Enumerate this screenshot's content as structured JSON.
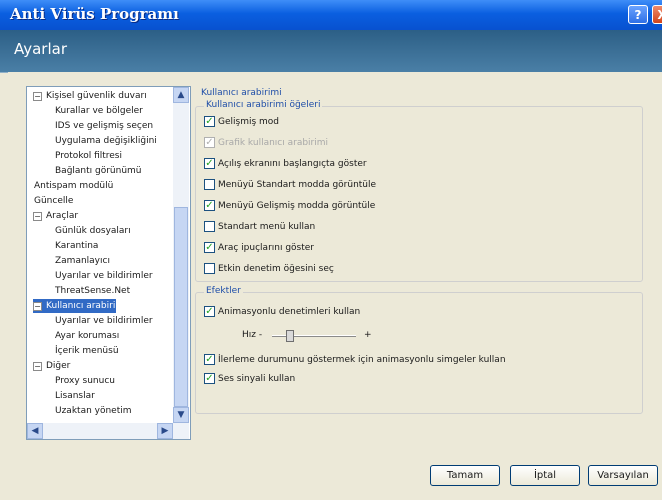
{
  "window": {
    "title": "Anti Virüs Programı"
  },
  "header": {
    "title": "Ayarlar"
  },
  "tree": [
    {
      "label": "Kişisel güvenlik duvarı",
      "expander": "minus",
      "level": 0
    },
    {
      "label": "Kurallar ve bölgeler",
      "level": 1
    },
    {
      "label": "IDS ve gelişmiş seçen",
      "level": 1
    },
    {
      "label": "Uygulama değişikliğini",
      "level": 1
    },
    {
      "label": "Protokol filtresi",
      "level": 1
    },
    {
      "label": "Bağlantı görünümü",
      "level": 1
    },
    {
      "label": "Antispam modülü",
      "level": 0
    },
    {
      "label": "Güncelle",
      "level": 0
    },
    {
      "label": "Araçlar",
      "expander": "minus",
      "level": 0
    },
    {
      "label": "Günlük dosyaları",
      "level": 1
    },
    {
      "label": "Karantina",
      "level": 1
    },
    {
      "label": "Zamanlayıcı",
      "level": 1
    },
    {
      "label": "Uyarılar ve bildirimler",
      "level": 1
    },
    {
      "label": "ThreatSense.Net",
      "level": 1
    },
    {
      "label": "Kullanıcı arabirimi",
      "expander": "minus",
      "level": 0,
      "selected": true
    },
    {
      "label": "Uyarılar ve bildirimler",
      "level": 1
    },
    {
      "label": "Ayar koruması",
      "level": 1
    },
    {
      "label": "İçerik menüsü",
      "level": 1
    },
    {
      "label": "Diğer",
      "expander": "minus",
      "level": 0
    },
    {
      "label": "Proxy sunucu",
      "level": 1
    },
    {
      "label": "Lisanslar",
      "level": 1
    },
    {
      "label": "Uzaktan yönetim",
      "level": 1
    }
  ],
  "content": {
    "section_title": "Kullanıcı arabirimi",
    "elements_group": "Kullanıcı arabirimi öğeleri",
    "options": [
      {
        "label": "Gelişmiş mod",
        "checked": true
      },
      {
        "label": "Grafik kullanıcı arabirimi",
        "checked": true,
        "disabled": true
      },
      {
        "label": "Açılış ekranını başlangıçta göster",
        "checked": true
      },
      {
        "label": "Menüyü Standart modda görüntüle",
        "checked": false
      },
      {
        "label": "Menüyü Gelişmiş modda görüntüle",
        "checked": true
      },
      {
        "label": "Standart menü kullan",
        "checked": false
      },
      {
        "label": "Araç ipuçlarını göster",
        "checked": true
      },
      {
        "label": "Etkin denetim öğesini seç",
        "checked": false
      }
    ],
    "effects_group": "Efektler",
    "effects": [
      {
        "label": "Animasyonlu denetimleri kullan",
        "checked": true
      },
      {
        "label": "İlerleme durumunu göstermek için animasyonlu simgeler kullan",
        "checked": true
      },
      {
        "label": "Ses sinyali kullan",
        "checked": true
      }
    ],
    "speed": {
      "label": "Hız -",
      "plus": "+",
      "level": 0.2
    }
  },
  "buttons": {
    "ok": "Tamam",
    "cancel": "İptal",
    "defaults": "Varsayılan"
  },
  "icons": {
    "help": "?",
    "close": "X",
    "check": "✓"
  }
}
